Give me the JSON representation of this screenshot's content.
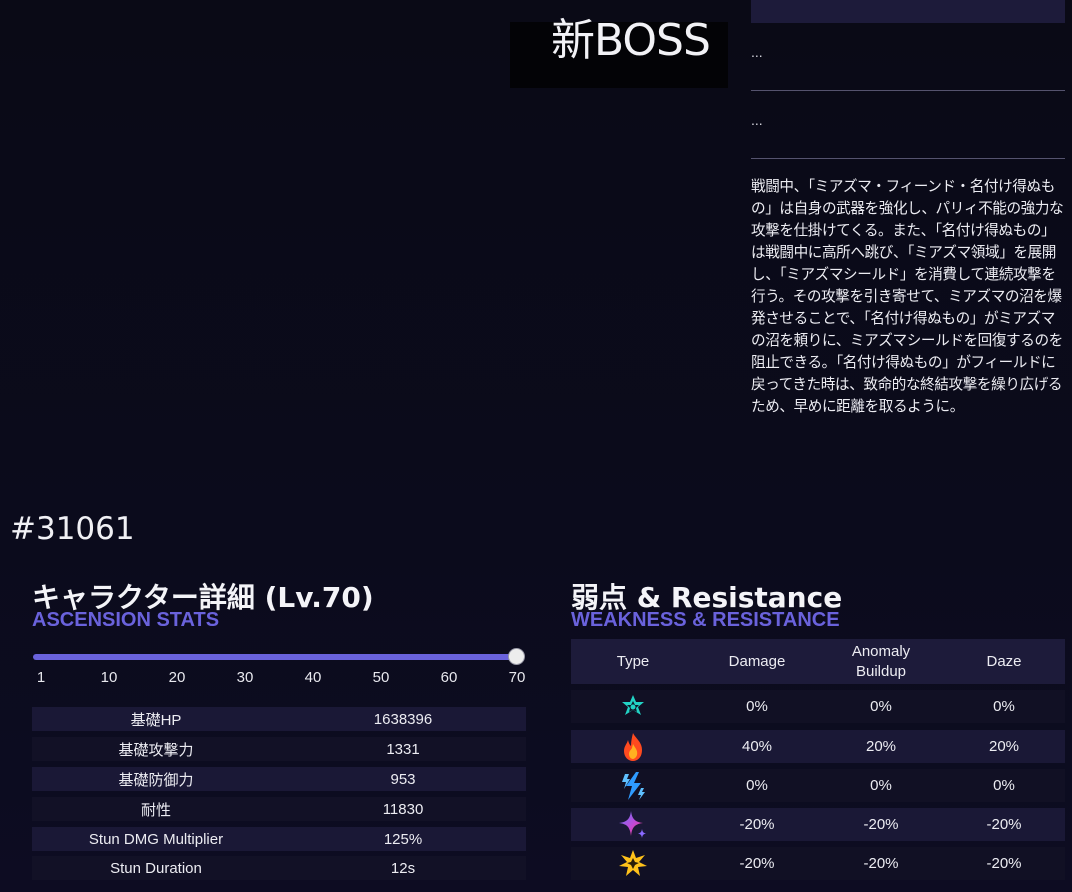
{
  "boss": {
    "title": "新BOSS",
    "id": "#31061",
    "line1": "...",
    "line2": "...",
    "description": "戦闘中、「ミアズマ・フィーンド・名付け得ぬもの」は自身の武器を強化し、パリィ不能の強力な攻撃を仕掛けてくる。また、「名付け得ぬもの」は戦闘中に高所へ跳び、「ミアズマ領域」を展開し、「ミアズマシールド」を消費して連続攻撃を行う。その攻撃を引き寄せて、ミアズマの沼を爆発させることで、「名付け得ぬもの」がミアズマの沼を頼りに、ミアズマシールドを回復するのを阻止できる。「名付け得ぬもの」がフィールドに戻ってきた時は、致命的な終結攻撃を繰り広げるため、早めに距離を取るように。"
  },
  "stats": {
    "title": "キャラクター詳細 (Lv.70)",
    "subtitle": "ASCENSION STATS",
    "level_ticks": [
      "1",
      "10",
      "20",
      "30",
      "40",
      "50",
      "60",
      "70"
    ],
    "level_value": 70,
    "rows": [
      {
        "label": "基礎HP",
        "value": "1638396"
      },
      {
        "label": "基礎攻撃力",
        "value": "1331"
      },
      {
        "label": "基礎防御力",
        "value": "953"
      },
      {
        "label": "耐性",
        "value": "11830"
      },
      {
        "label": "Stun DMG Multiplier",
        "value": "125%"
      },
      {
        "label": "Stun Duration",
        "value": "12s"
      }
    ]
  },
  "weakness": {
    "title": "弱点 & Resistance",
    "subtitle": "WEAKNESS & RESISTANCE",
    "headers": {
      "type": "Type",
      "damage": "Damage",
      "anomaly": "Anomaly\nBuildup",
      "daze": "Daze"
    },
    "rows": [
      {
        "icon": "physical-icon",
        "color": "#22d3c5",
        "damage": "0%",
        "anomaly": "0%",
        "daze": "0%"
      },
      {
        "icon": "fire-icon",
        "color": "#ff4a1f",
        "damage": "40%",
        "anomaly": "20%",
        "daze": "20%"
      },
      {
        "icon": "electric-icon",
        "color": "#2f9bff",
        "damage": "0%",
        "anomaly": "0%",
        "daze": "0%"
      },
      {
        "icon": "ether-icon",
        "color": "#e0408a",
        "damage": "-20%",
        "anomaly": "-20%",
        "daze": "-20%"
      },
      {
        "icon": "ice-icon",
        "color": "#ffc21a",
        "damage": "-20%",
        "anomaly": "-20%",
        "daze": "-20%"
      }
    ]
  },
  "colors": {
    "accent": "#6a62dc",
    "header_bg": "#1d1b3a"
  }
}
